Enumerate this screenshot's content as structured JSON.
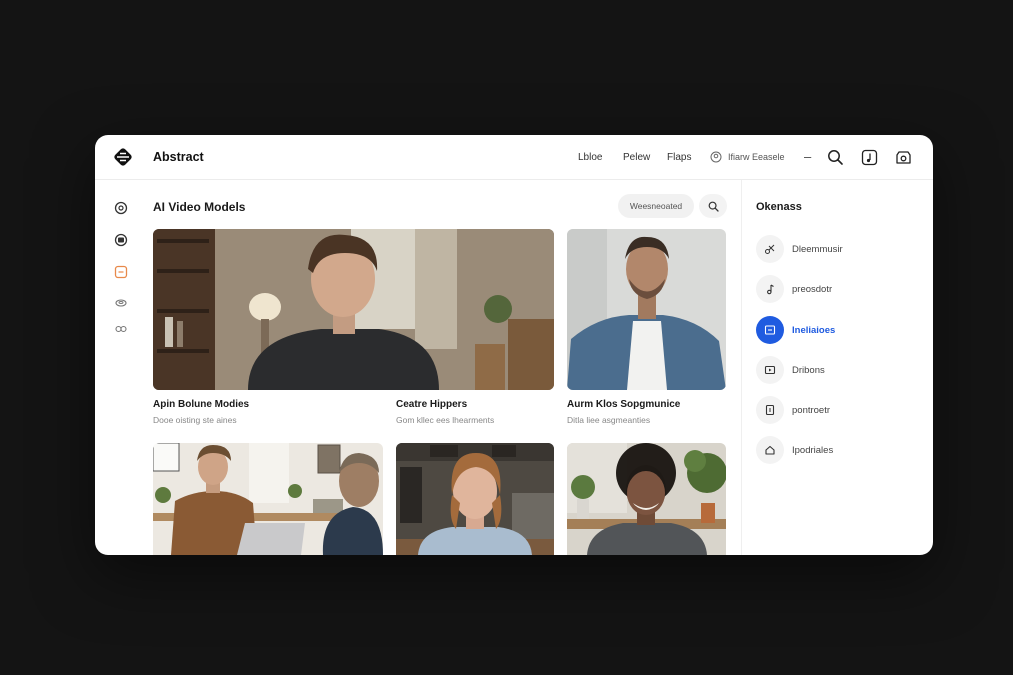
{
  "app": {
    "title": "Abstract"
  },
  "header": {
    "nav": [
      "Lbloe",
      "Pelew",
      "Flaps"
    ],
    "account_label": "Ifiarw Eeasele",
    "icons": [
      "user-icon",
      "search-icon",
      "music-icon",
      "settings-icon"
    ]
  },
  "sidebar": {
    "icons": [
      "compass-icon",
      "record-icon",
      "media-icon",
      "cloud-icon",
      "link-icon"
    ],
    "active_index": 2
  },
  "main": {
    "section_title": "AI Video Models",
    "filter_label": "Weesneoated",
    "cards": [
      {
        "title": "Apin Bolune Modies",
        "subtitle": "Dooe oisting ste aines"
      },
      {
        "title": "Ceatre Hippers",
        "subtitle": "Gom kllec ees lhearments"
      },
      {
        "title": "Aurm Klos Sopgmunice",
        "subtitle": "Ditla liee asgmeanties"
      },
      {
        "title": "",
        "subtitle": ""
      },
      {
        "title": "",
        "subtitle": ""
      },
      {
        "title": "",
        "subtitle": ""
      }
    ]
  },
  "panel": {
    "title": "Okenass",
    "items": [
      {
        "label": "Dleemmusir",
        "icon": "scissors-icon"
      },
      {
        "label": "preosdotr",
        "icon": "music-note-icon"
      },
      {
        "label": "Ineliaioes",
        "icon": "caption-icon"
      },
      {
        "label": "Dribons",
        "icon": "video-icon"
      },
      {
        "label": "pontroetr",
        "icon": "document-icon"
      },
      {
        "label": "Ipodriales",
        "icon": "home-icon"
      }
    ],
    "active_index": 2
  },
  "colors": {
    "accent": "#1f5be0",
    "active_rail": "#e8894a",
    "background": "#141414"
  }
}
